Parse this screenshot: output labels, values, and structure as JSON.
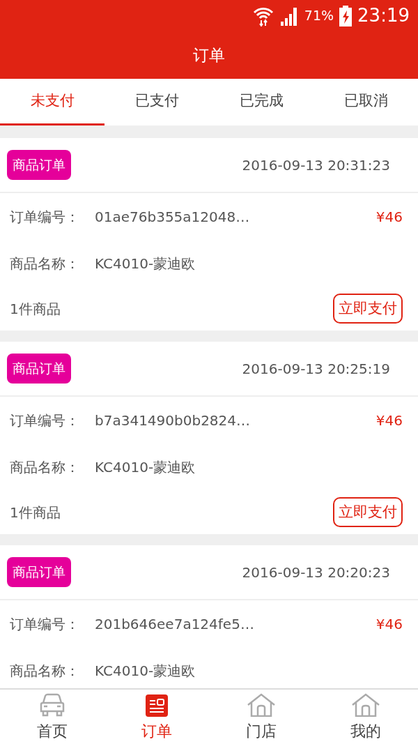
{
  "status_bar": {
    "battery": "71%",
    "time": "23:19"
  },
  "window": {
    "title": "订单"
  },
  "tabs": [
    {
      "label": "未支付",
      "selected": true
    },
    {
      "label": "已支付",
      "selected": false
    },
    {
      "label": "已完成",
      "selected": false
    },
    {
      "label": "已取消",
      "selected": false
    }
  ],
  "orders": [
    {
      "tag": "商品订单",
      "time": "2016-09-13 20:31:23",
      "order_no_label": "订单编号：",
      "order_no": "01ae76b355a12048…",
      "price": "¥46",
      "product_label": "商品名称：",
      "product": "KC4010-蒙迪欧",
      "count": "1件商品",
      "action": "立即支付"
    },
    {
      "tag": "商品订单",
      "time": "2016-09-13 20:25:19",
      "order_no_label": "订单编号：",
      "order_no": "b7a341490b0b2824…",
      "price": "¥46",
      "product_label": "商品名称：",
      "product": "KC4010-蒙迪欧",
      "count": "1件商品",
      "action": "立即支付"
    },
    {
      "tag": "商品订单",
      "time": "2016-09-13 20:20:23",
      "order_no_label": "订单编号：",
      "order_no": "201b646ee7a124fe5…",
      "price": "¥46",
      "product_label": "商品名称：",
      "product": "KC4010-蒙迪欧"
    }
  ],
  "bottom_nav": [
    {
      "kind": "car",
      "label": "首页",
      "selected": false
    },
    {
      "kind": "list",
      "label": "订单",
      "selected": true
    },
    {
      "kind": "house",
      "label": "门店",
      "selected": false
    },
    {
      "kind": "house",
      "label": "我的",
      "selected": false
    }
  ]
}
